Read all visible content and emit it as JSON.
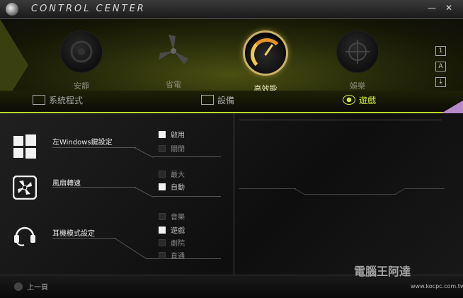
{
  "app": {
    "title": "CONTROL CENTER",
    "window_buttons": [
      "—",
      "✕"
    ]
  },
  "modes": [
    {
      "label": "安靜",
      "icon": "speaker-icon",
      "active": false
    },
    {
      "label": "省電",
      "icon": "fan-icon",
      "active": false
    },
    {
      "label": "高效能",
      "icon": "gauge-icon",
      "active": true
    },
    {
      "label": "娛樂",
      "icon": "target-icon",
      "active": false
    }
  ],
  "side_icons": [
    "1",
    "A",
    "⇣",
    "✈"
  ],
  "tabs": [
    {
      "label": "系統程式",
      "icon": "monitor-icon",
      "active": false
    },
    {
      "label": "設備",
      "icon": "usb-icon",
      "active": false
    },
    {
      "label": "遊戲",
      "icon": "eye-icon",
      "active": true
    }
  ],
  "settings": [
    {
      "label": "左Windows鍵設定",
      "icon": "windows-logo-icon",
      "options": [
        {
          "label": "啟用",
          "checked": true
        },
        {
          "label": "關閉",
          "checked": false
        }
      ]
    },
    {
      "label": "風扇轉速",
      "icon": "fan-box-icon",
      "options": [
        {
          "label": "最大",
          "checked": false
        },
        {
          "label": "自動",
          "checked": true
        }
      ]
    },
    {
      "label": "耳機模式設定",
      "icon": "headset-icon",
      "options": [
        {
          "label": "音樂",
          "checked": false
        },
        {
          "label": "遊戲",
          "checked": true
        },
        {
          "label": "劇院",
          "checked": false
        },
        {
          "label": "直通",
          "checked": false
        }
      ]
    }
  ],
  "footer": {
    "back_label": "上一頁"
  },
  "watermark": {
    "text": "電腦王阿達",
    "url": "www.kocpc.com.tw"
  },
  "colors": {
    "accent": "#d6ef3a",
    "panel_bg": "#0d0d0d",
    "purple": "#b68ac8"
  }
}
